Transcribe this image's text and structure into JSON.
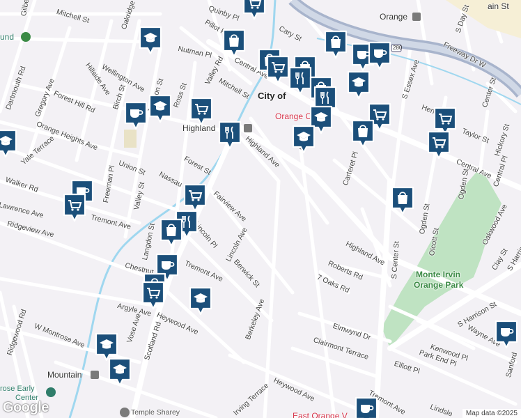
{
  "map": {
    "attribution": "Map data ©2025",
    "logo": "Google",
    "colors": {
      "marker_fill": "#1b4f7a",
      "marker_border": "#ffffff",
      "park": "#bfe3c2",
      "road": "#ffffff",
      "highway": "#a8b4cc",
      "creek": "#9fd7ef"
    }
  },
  "place_labels": {
    "city": "City of",
    "orange": "Orange",
    "highland": "Highland",
    "orange_center": "Orange Center",
    "monte_irvin_1": "Monte Irvin",
    "monte_irvin_2": "Orange Park",
    "mountain": "Mountain",
    "rose_early_1": "rose Early",
    "rose_early_2": "Center",
    "temple": "Temple Sharey",
    "east_orange": "East Orange V",
    "und": "und",
    "main_st": "ain St"
  },
  "streets": {
    "mitchell_w": "Mitchell St",
    "quinby": "Quinby Pl",
    "pillot": "Pillot Pl",
    "cary": "Cary St",
    "gilbert": "Gilbert",
    "oakridge": "Oakridge Rd",
    "nutman": "Nutman Pl",
    "central_w": "Central Ave",
    "valley_rd": "Valley Rd",
    "hillside": "Hillside Ave",
    "wellington": "Wellington Ave",
    "dartmouth": "Dartmouth Rd",
    "gregory": "Gregory Ave",
    "forest_hill": "Forest Hill Rd",
    "birch": "Birch St",
    "jackson": "Jackson St",
    "ross": "Ross St",
    "mitchell_e": "Mitchell St",
    "orange_heights": "Orange Heights Ave",
    "yale": "Yale Terrace",
    "union": "Union St",
    "forest": "Forest St",
    "highland_ave": "Highland Ave",
    "walker": "Walker Rd",
    "freeman": "Freeman Pl",
    "valley_st": "Valley St",
    "nassau": "Nassau",
    "fairview": "Fairview Ave",
    "lawrence": "Lawrence Ave",
    "tremont_w": "Tremont Ave",
    "ridgeview": "Ridgeview Ave",
    "langdon": "Langdon St",
    "lincoln_pl": "Lincoln Pl",
    "lincoln_ave": "Lincoln Ave",
    "chestnut": "Chestnut",
    "tremont_mid": "Tremont Ave",
    "berwick": "Berwick St",
    "argyle": "Argyle Ave",
    "vose": "Vose Ave",
    "scotland": "Scotland Rd",
    "heywood_w": "Heywood Ave",
    "berkeley": "Berkeley Ave",
    "w_montrose": "W Montrose Ave",
    "ridgewood": "Ridgewood Rd",
    "irving": "Irving Terrace",
    "heywood_e": "Heywood Ave",
    "freeway": "Freeway Dr W",
    "s_day": "S Day St",
    "center_st": "Center St",
    "s_essex": "S Essex Ave",
    "henry": "Henry St",
    "taylor": "Taylor St",
    "hickory": "Hickory St",
    "central_e": "Central Ave",
    "central_pl": "Central Pl",
    "carteret": "Carteret Pl",
    "ogden": "Ogden St",
    "olcott": "Olcott St",
    "oakwood": "Oakwood Ave",
    "clay": "Clay St",
    "s_harrison": "S Harrison St",
    "s_harrison2": "S Harris",
    "s_center": "S Center St",
    "highland_e": "Highland Ave",
    "roberts": "Roberts Rd",
    "oaks": "7 Oaks Rd",
    "elmwynd": "Elmwynd Dr",
    "clairmont": "Clairmont Terrace",
    "elliott": "Elliott Pl",
    "kenwood": "Kenwood Pl",
    "park_end": "Park End Pl",
    "wayne": "Wayne Ave",
    "sanford": "Sanford",
    "tremont_e": "Tremont Ave",
    "lindsley": "Lindsle",
    "li": "Li",
    "highway_shield": "280"
  },
  "markers": [
    {
      "icon": "shopping-cart-icon",
      "name": "marker-cart-top"
    },
    {
      "icon": "school-icon",
      "name": "marker-school-oakridge"
    },
    {
      "icon": "shopping-bag-icon",
      "name": "marker-bag-valley"
    },
    {
      "icon": "shopping-bag-icon",
      "name": "marker-bag-cary"
    },
    {
      "icon": "coffee-icon",
      "name": "marker-coffee-freeway-1"
    },
    {
      "icon": "coffee-icon",
      "name": "marker-coffee-freeway-2"
    },
    {
      "icon": "shopping-bag-icon",
      "name": "marker-bag-center-1"
    },
    {
      "icon": "shopping-cart-icon",
      "name": "marker-cart-center-1"
    },
    {
      "icon": "shopping-bag-icon",
      "name": "marker-bag-center-2"
    },
    {
      "icon": "restaurant-icon",
      "name": "marker-restaurant-center-1"
    },
    {
      "icon": "shopping-bag-icon",
      "name": "marker-bag-center-3"
    },
    {
      "icon": "school-icon",
      "name": "marker-school-essex"
    },
    {
      "icon": "restaurant-icon",
      "name": "marker-restaurant-center-2"
    },
    {
      "icon": "school-icon",
      "name": "marker-school-center"
    },
    {
      "icon": "shopping-cart-icon",
      "name": "marker-cart-essex"
    },
    {
      "icon": "shopping-cart-icon",
      "name": "marker-cart-henry"
    },
    {
      "icon": "school-icon",
      "name": "marker-school-li"
    },
    {
      "icon": "shopping-bag-icon",
      "name": "marker-bag-carteret"
    },
    {
      "icon": "shopping-cart-icon",
      "name": "marker-cart-taylor"
    },
    {
      "icon": "coffee-icon",
      "name": "marker-coffee-wellington"
    },
    {
      "icon": "school-icon",
      "name": "marker-school-ross"
    },
    {
      "icon": "shopping-cart-icon",
      "name": "marker-cart-highland"
    },
    {
      "icon": "restaurant-icon",
      "name": "marker-restaurant-highland"
    },
    {
      "icon": "school-icon",
      "name": "marker-school-heights"
    },
    {
      "icon": "coffee-icon",
      "name": "marker-coffee-walker"
    },
    {
      "icon": "shopping-cart-icon",
      "name": "marker-cart-tremont"
    },
    {
      "icon": "shopping-cart-icon",
      "name": "marker-cart-fairview"
    },
    {
      "icon": "restaurant-icon",
      "name": "marker-restaurant-lincoln"
    },
    {
      "icon": "shopping-bag-icon",
      "name": "marker-bag-lincoln"
    },
    {
      "icon": "shopping-bag-icon",
      "name": "marker-bag-ogden"
    },
    {
      "icon": "coffee-icon",
      "name": "marker-coffee-tremont"
    },
    {
      "icon": "shopping-bag-icon",
      "name": "marker-bag-montrose"
    },
    {
      "icon": "shopping-cart-icon",
      "name": "marker-cart-montrose"
    },
    {
      "icon": "school-icon",
      "name": "marker-school-heywood"
    },
    {
      "icon": "school-icon",
      "name": "marker-school-scotland"
    },
    {
      "icon": "school-icon",
      "name": "marker-school-mountain"
    },
    {
      "icon": "coffee-icon",
      "name": "marker-coffee-wayne"
    },
    {
      "icon": "coffee-icon",
      "name": "marker-coffee-tremont-e"
    }
  ]
}
